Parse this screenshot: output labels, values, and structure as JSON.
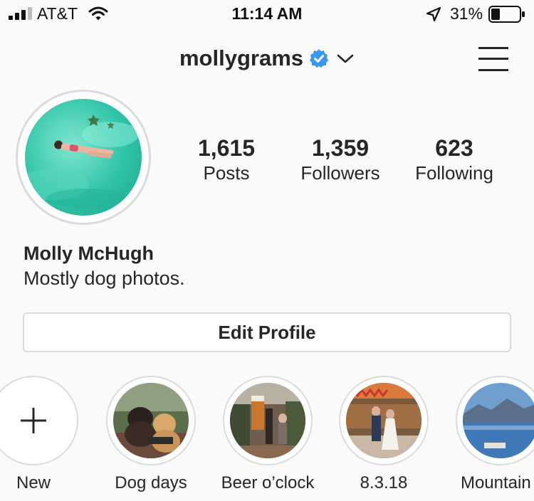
{
  "status_bar": {
    "carrier": "AT&T",
    "time": "11:14 AM",
    "battery_percent": "31%",
    "battery_level": 0.31
  },
  "header": {
    "username": "mollygrams",
    "verified": true
  },
  "profile": {
    "stats": [
      {
        "value": "1,615",
        "label": "Posts"
      },
      {
        "value": "1,359",
        "label": "Followers"
      },
      {
        "value": "623",
        "label": "Following"
      }
    ],
    "full_name": "Molly McHugh",
    "bio": "Mostly dog photos.",
    "edit_button_label": "Edit Profile"
  },
  "highlights": [
    {
      "label": "New",
      "icon": "plus-icon"
    },
    {
      "label": "Dog days"
    },
    {
      "label": "Beer o’clock"
    },
    {
      "label": "8.3.18"
    },
    {
      "label": "Mountain t"
    }
  ],
  "colors": {
    "verified_blue": "#3897f0",
    "background": "#fafafa",
    "border": "#dbdbdb",
    "text": "#262626"
  }
}
